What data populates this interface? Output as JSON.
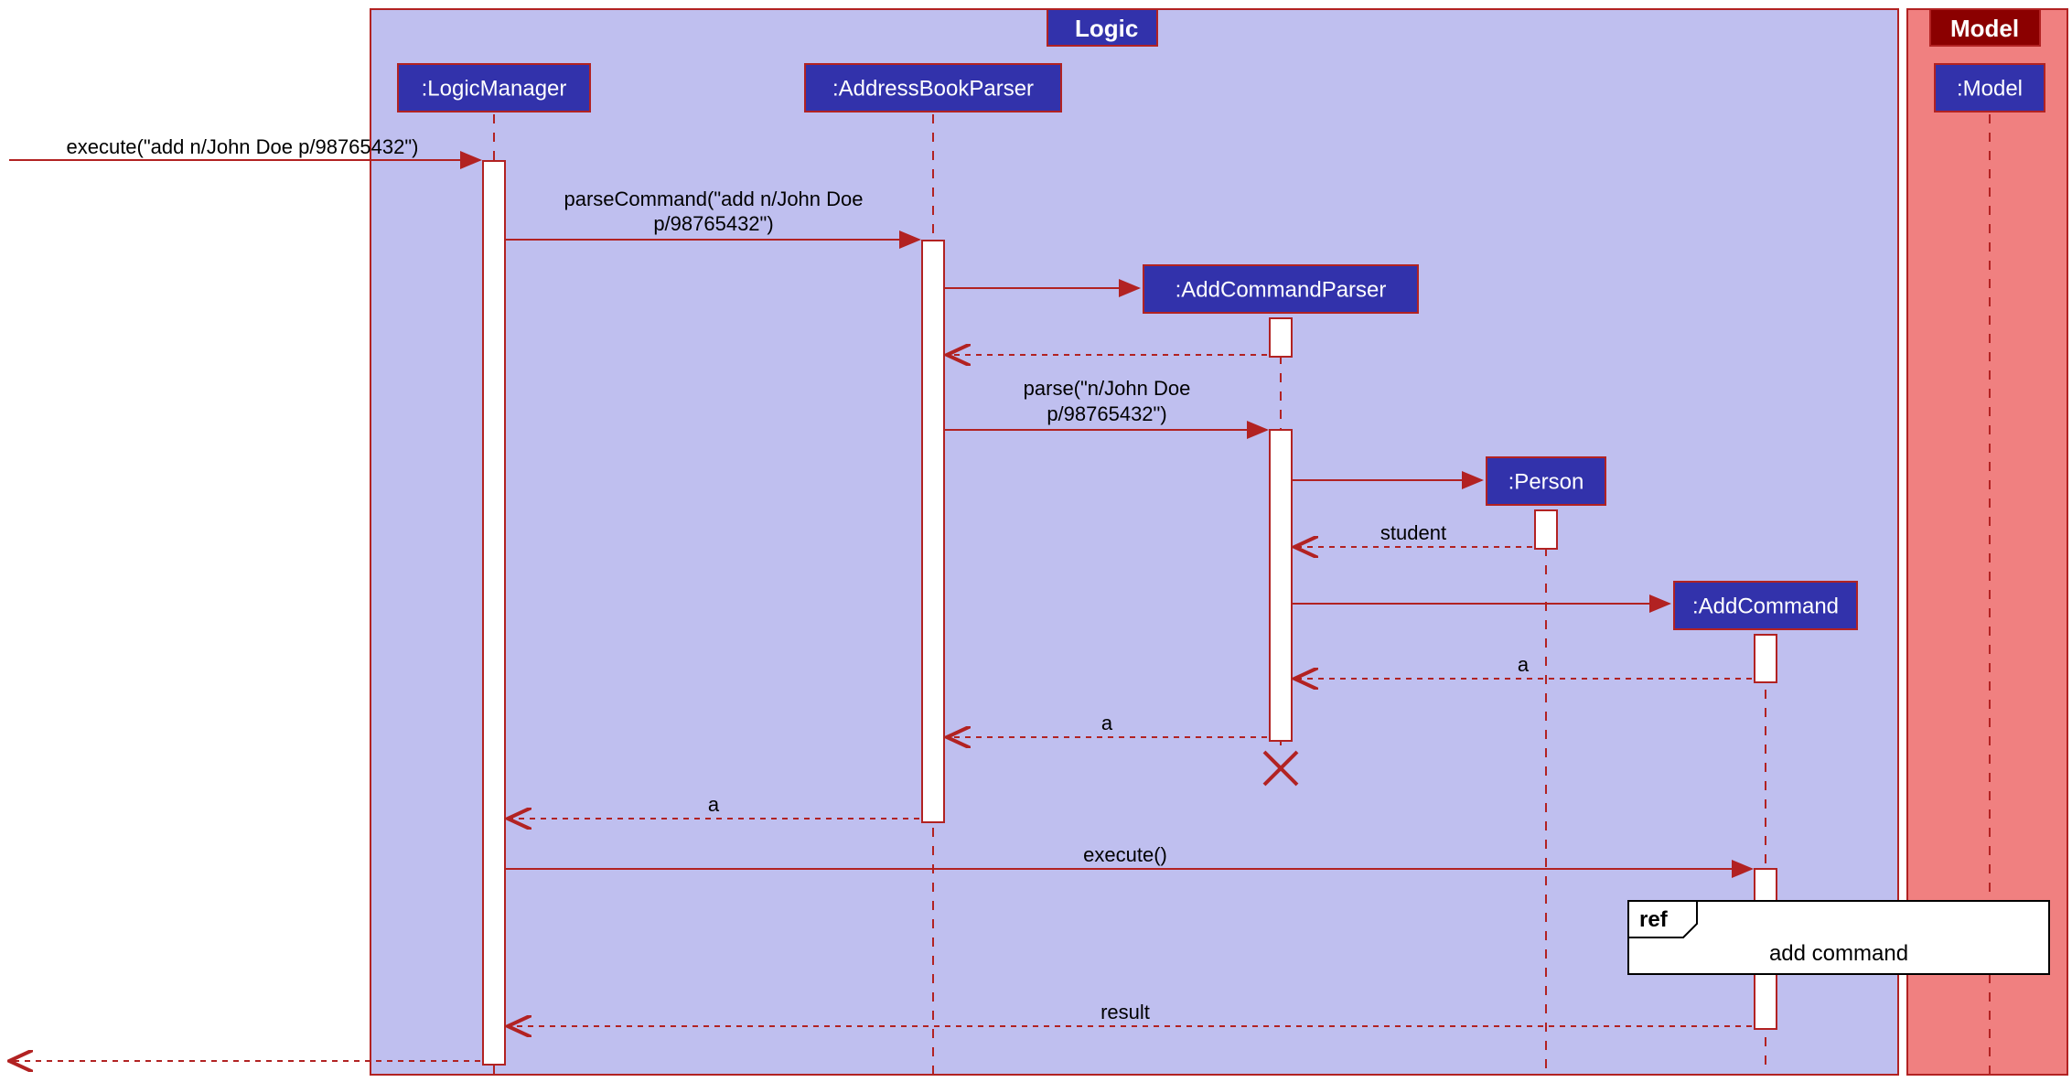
{
  "frames": {
    "logic": "Logic",
    "model": "Model"
  },
  "participants": {
    "logicManager": ":LogicManager",
    "addressBookParser": ":AddressBookParser",
    "addCommandParser": ":AddCommandParser",
    "person": ":Person",
    "addCommand": ":AddCommand",
    "model": ":Model"
  },
  "messages": {
    "execute_initial": "execute(\"add n/John Doe p/98765432\")",
    "parseCommand_line1": "parseCommand(\"add n/John Doe",
    "parseCommand_line2": "p/98765432\")",
    "parse_line1": "parse(\"n/John Doe",
    "parse_line2": "p/98765432\")",
    "student": "student",
    "a": "a",
    "execute": "execute()",
    "result": "result"
  },
  "ref": {
    "label": "ref",
    "content": "add command"
  },
  "chart_data": {
    "type": "uml-sequence-diagram",
    "frames": [
      {
        "name": "Logic",
        "contains": [
          ":LogicManager",
          ":AddressBookParser",
          ":AddCommandParser",
          ":Person",
          ":AddCommand"
        ]
      },
      {
        "name": "Model",
        "contains": [
          ":Model"
        ]
      }
    ],
    "participants": [
      ":LogicManager",
      ":AddressBookParser",
      ":AddCommandParser",
      ":Person",
      ":AddCommand",
      ":Model"
    ],
    "interactions": [
      {
        "from": "external",
        "to": ":LogicManager",
        "label": "execute(\"add n/John Doe p/98765432\")",
        "type": "sync"
      },
      {
        "from": ":LogicManager",
        "to": ":AddressBookParser",
        "label": "parseCommand(\"add n/John Doe p/98765432\")",
        "type": "sync"
      },
      {
        "from": ":AddressBookParser",
        "to": ":AddCommandParser",
        "label": "",
        "type": "create"
      },
      {
        "from": ":AddCommandParser",
        "to": ":AddressBookParser",
        "label": "",
        "type": "return"
      },
      {
        "from": ":AddressBookParser",
        "to": ":AddCommandParser",
        "label": "parse(\"n/John Doe p/98765432\")",
        "type": "sync"
      },
      {
        "from": ":AddCommandParser",
        "to": ":Person",
        "label": "",
        "type": "create"
      },
      {
        "from": ":Person",
        "to": ":AddCommandParser",
        "label": "student",
        "type": "return"
      },
      {
        "from": ":AddCommandParser",
        "to": ":AddCommand",
        "label": "",
        "type": "create"
      },
      {
        "from": ":AddCommand",
        "to": ":AddCommandParser",
        "label": "a",
        "type": "return"
      },
      {
        "from": ":AddCommandParser",
        "to": ":AddressBookParser",
        "label": "a",
        "type": "return"
      },
      {
        "from": ":AddCommandParser",
        "to": null,
        "label": "",
        "type": "destroy"
      },
      {
        "from": ":AddressBookParser",
        "to": ":LogicManager",
        "label": "a",
        "type": "return"
      },
      {
        "from": ":LogicManager",
        "to": ":AddCommand",
        "label": "execute()",
        "type": "sync"
      },
      {
        "from": ":AddCommand",
        "to": "ref",
        "label": "add command",
        "type": "ref"
      },
      {
        "from": ":AddCommand",
        "to": ":LogicManager",
        "label": "result",
        "type": "return"
      },
      {
        "from": ":LogicManager",
        "to": "external",
        "label": "",
        "type": "return"
      }
    ]
  }
}
